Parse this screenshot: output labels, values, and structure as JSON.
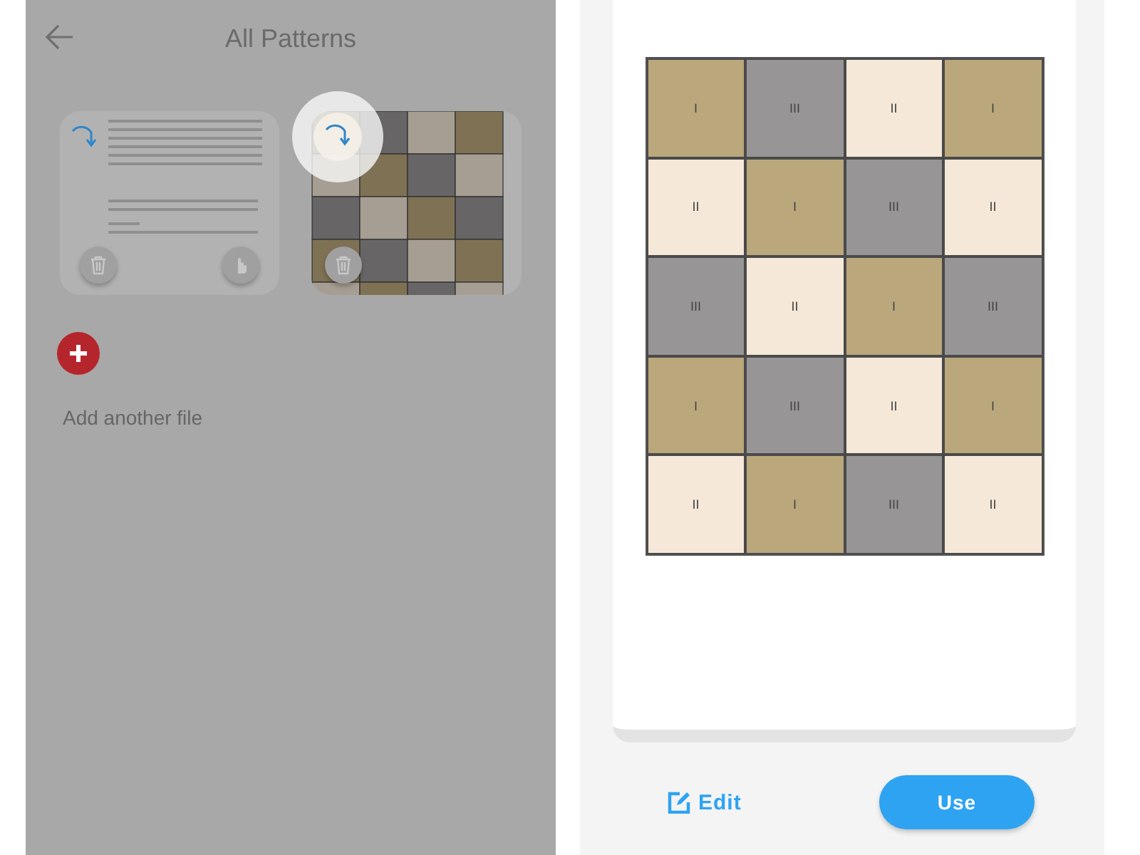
{
  "left_screen": {
    "title": "All Patterns",
    "files": [
      {
        "kind": "document",
        "highlighted": false
      },
      {
        "kind": "pattern",
        "highlighted": true
      }
    ],
    "add_label": "Add another file"
  },
  "pattern": {
    "rows": [
      [
        {
          "label": "I",
          "color": "#bba77c"
        },
        {
          "label": "III",
          "color": "#979596"
        },
        {
          "label": "II",
          "color": "#f5e8d8"
        },
        {
          "label": "I",
          "color": "#bba77c"
        }
      ],
      [
        {
          "label": "II",
          "color": "#f5e8d8"
        },
        {
          "label": "I",
          "color": "#bba77c"
        },
        {
          "label": "III",
          "color": "#979596"
        },
        {
          "label": "II",
          "color": "#f5e8d8"
        }
      ],
      [
        {
          "label": "III",
          "color": "#979596"
        },
        {
          "label": "II",
          "color": "#f5e8d8"
        },
        {
          "label": "I",
          "color": "#bba77c"
        },
        {
          "label": "III",
          "color": "#979596"
        }
      ],
      [
        {
          "label": "I",
          "color": "#bba77c"
        },
        {
          "label": "III",
          "color": "#979596"
        },
        {
          "label": "II",
          "color": "#f5e8d8"
        },
        {
          "label": "I",
          "color": "#bba77c"
        }
      ],
      [
        {
          "label": "II",
          "color": "#f5e8d8"
        },
        {
          "label": "I",
          "color": "#bba77c"
        },
        {
          "label": "III",
          "color": "#979596"
        },
        {
          "label": "II",
          "color": "#f5e8d8"
        }
      ]
    ]
  },
  "actions": {
    "edit": "Edit",
    "use": "Use"
  }
}
